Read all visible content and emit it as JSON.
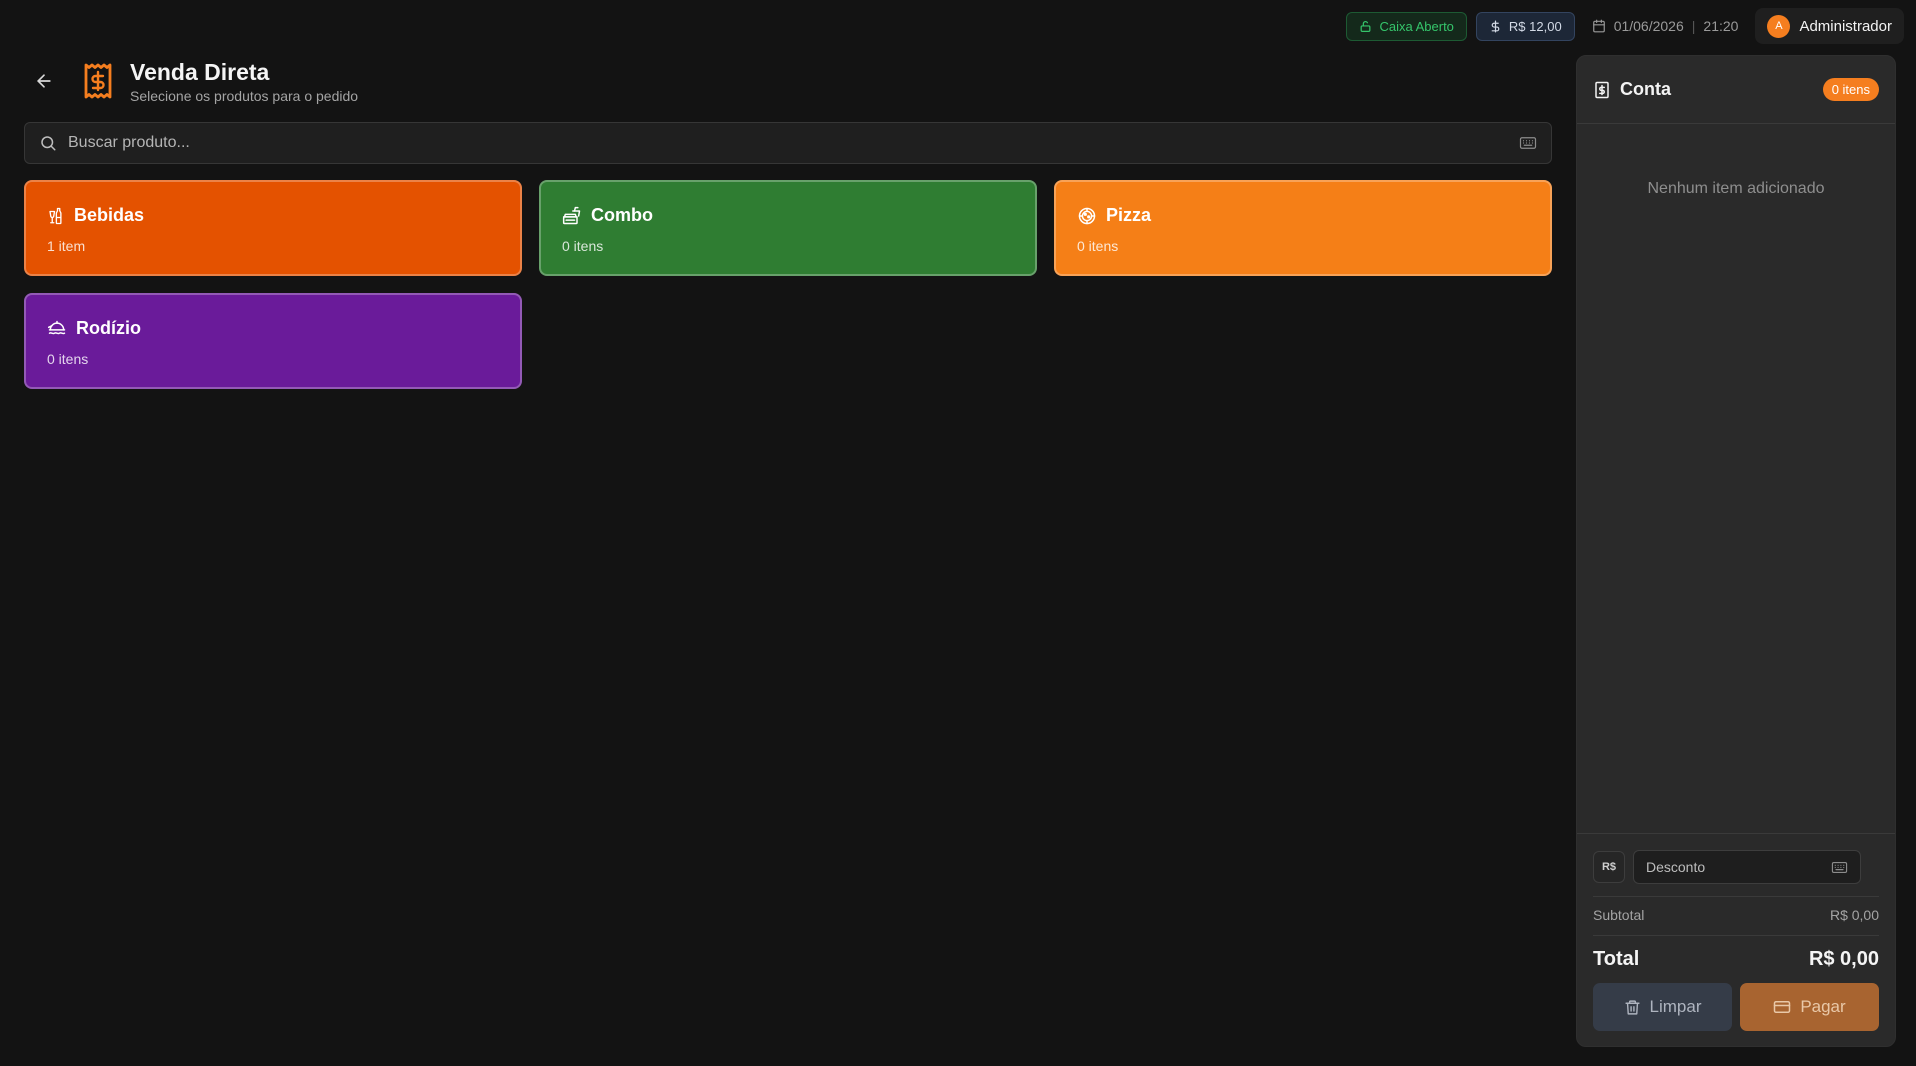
{
  "topbar": {
    "caixa_status": "Caixa Aberto",
    "saldo": "R$ 12,00",
    "date": "01/06/2026",
    "separator": "|",
    "time": "21:20",
    "user_initial": "A",
    "user_name": "Administrador"
  },
  "header": {
    "title": "Venda Direta",
    "subtitle": "Selecione os produtos para o pedido"
  },
  "search": {
    "placeholder": "Buscar produto..."
  },
  "categories": [
    {
      "name": "Bebidas",
      "count": "1 item",
      "color": "#e45200",
      "icon": "bottle-icon"
    },
    {
      "name": "Combo",
      "count": "0 itens",
      "color": "#2f7d32",
      "icon": "combo-icon"
    },
    {
      "name": "Pizza",
      "count": "0 itens",
      "color": "#f57f17",
      "icon": "pizza-icon"
    },
    {
      "name": "Rodízio",
      "count": "0 itens",
      "color": "#6a1b9a",
      "icon": "rodizio-icon"
    }
  ],
  "order": {
    "title": "Conta",
    "badge": "0 itens",
    "empty_message": "Nenhum item adicionado",
    "currency_toggle": "R$",
    "discount_placeholder": "Desconto",
    "subtotal_label": "Subtotal",
    "subtotal_value": "R$ 0,00",
    "total_label": "Total",
    "total_value": "R$ 0,00",
    "clear_label": "Limpar",
    "pay_label": "Pagar"
  },
  "colors": {
    "accent": "#f57e1f",
    "background": "#131313",
    "panel": "#2a2a2a",
    "caixa_green": "#35c56b"
  }
}
